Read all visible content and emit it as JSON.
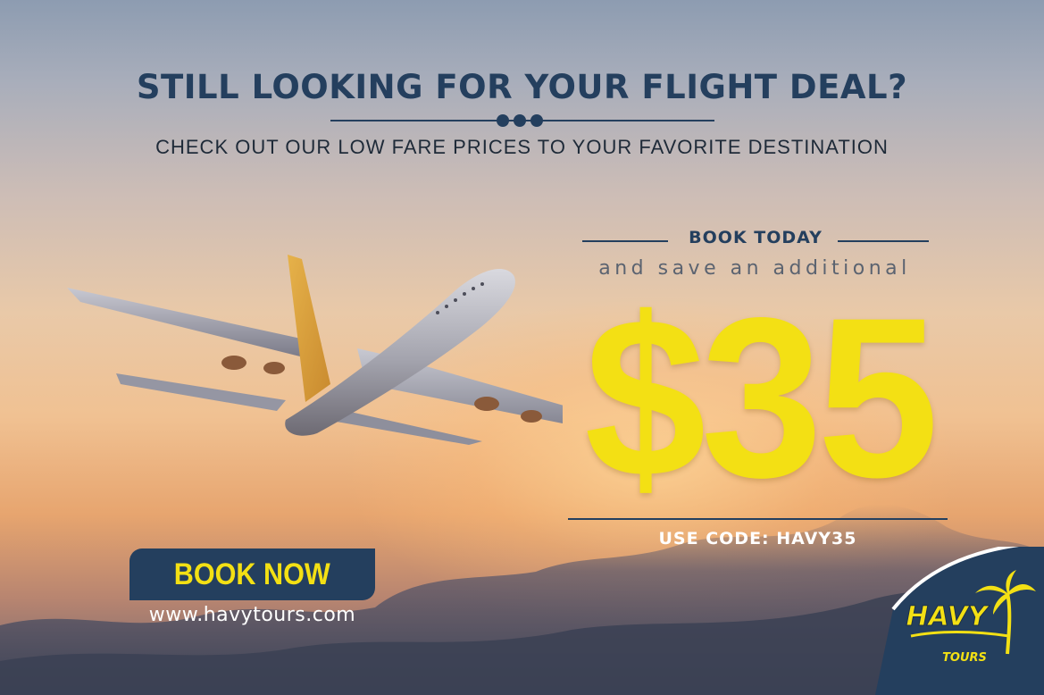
{
  "headline": "STILL LOOKING FOR YOUR FLIGHT DEAL?",
  "subheadline": "CHECK OUT OUR LOW FARE PRICES TO YOUR FAVORITE DESTINATION",
  "offer": {
    "book_today": "BOOK TODAY",
    "save_text": "and save an additional",
    "price": "$35",
    "code_text": "USE CODE: HAVY35"
  },
  "cta": {
    "book_now_label": "BOOK NOW",
    "website": "www.havytours.com"
  },
  "logo": {
    "brand": "HAVY",
    "tagline": "TOURS"
  },
  "colors": {
    "navy": "#243f5e",
    "yellow": "#f3e014",
    "white": "#ffffff"
  }
}
